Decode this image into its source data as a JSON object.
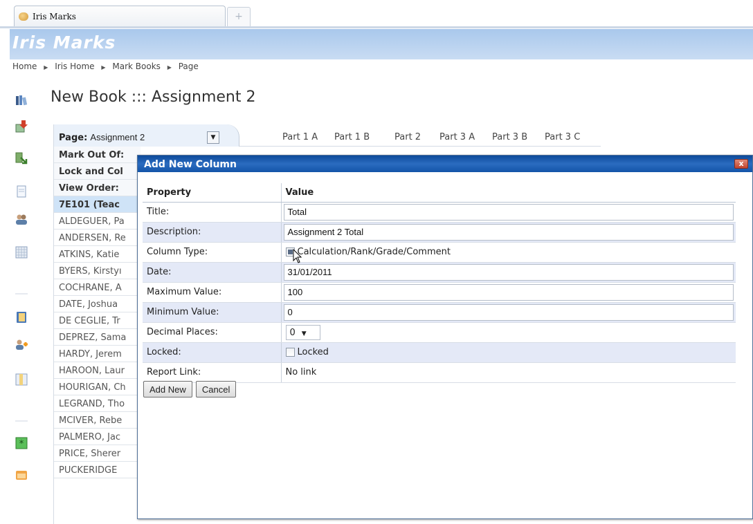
{
  "browser": {
    "tab_title": "Iris Marks",
    "new_tab_glyph": "+"
  },
  "app": {
    "title": "Iris Marks"
  },
  "breadcrumb": [
    "Home",
    "Iris Home",
    "Mark Books",
    "Page"
  ],
  "page_title": "New Book ::: Assignment 2",
  "sidebar_icons": [
    "books-icon",
    "import-icon",
    "export-icon",
    "document-icon",
    "students-icon",
    "grid-icon",
    "book-info-icon",
    "add-students-icon",
    "columns-icon",
    "calculator-icon",
    "folder-icon"
  ],
  "grid": {
    "page_label": "Page:",
    "page_value": "Assignment 2",
    "columns": [
      "Part 1 A",
      "Part 1 B",
      "Part 2",
      "Part 3 A",
      "Part 3 B",
      "Part 3 C"
    ],
    "row_labels": [
      "Mark Out Of:",
      "Lock and Col",
      "View Order:"
    ],
    "group": "7E101 (Teac",
    "students": [
      "ALDEGUER, Pa",
      "ANDERSEN, Re",
      "ATKINS, Katie",
      "BYERS, Kirstyı",
      "COCHRANE, A",
      "DATE, Joshua",
      "DE CEGLIE, Tr",
      "DEPREZ, Sama",
      "HARDY, Jerem",
      "HAROON, Laur",
      "HOURIGAN, Ch",
      "LEGRAND, Tho",
      "MCIVER, Rebe",
      "PALMERO, Jac",
      "PRICE, Sherer",
      "PUCKERIDGE"
    ]
  },
  "dialog": {
    "title": "Add New Column",
    "close_glyph": "x",
    "header_property": "Property",
    "header_value": "Value",
    "fields": {
      "title_label": "Title:",
      "title_value": "Total",
      "description_label": "Description:",
      "description_value": "Assignment 2 Total",
      "column_type_label": "Column Type:",
      "column_type_option": "Calculation/Rank/Grade/Comment",
      "date_label": "Date:",
      "date_value": "31/01/2011",
      "max_label": "Maximum Value:",
      "max_value": "100",
      "min_label": "Minimum Value:",
      "min_value": "0",
      "decimal_label": "Decimal Places:",
      "decimal_value": "0",
      "locked_label": "Locked:",
      "locked_option": "Locked",
      "report_label": "Report Link:",
      "report_value": "No link"
    },
    "buttons": {
      "add_new": "Add New",
      "cancel": "Cancel"
    }
  }
}
